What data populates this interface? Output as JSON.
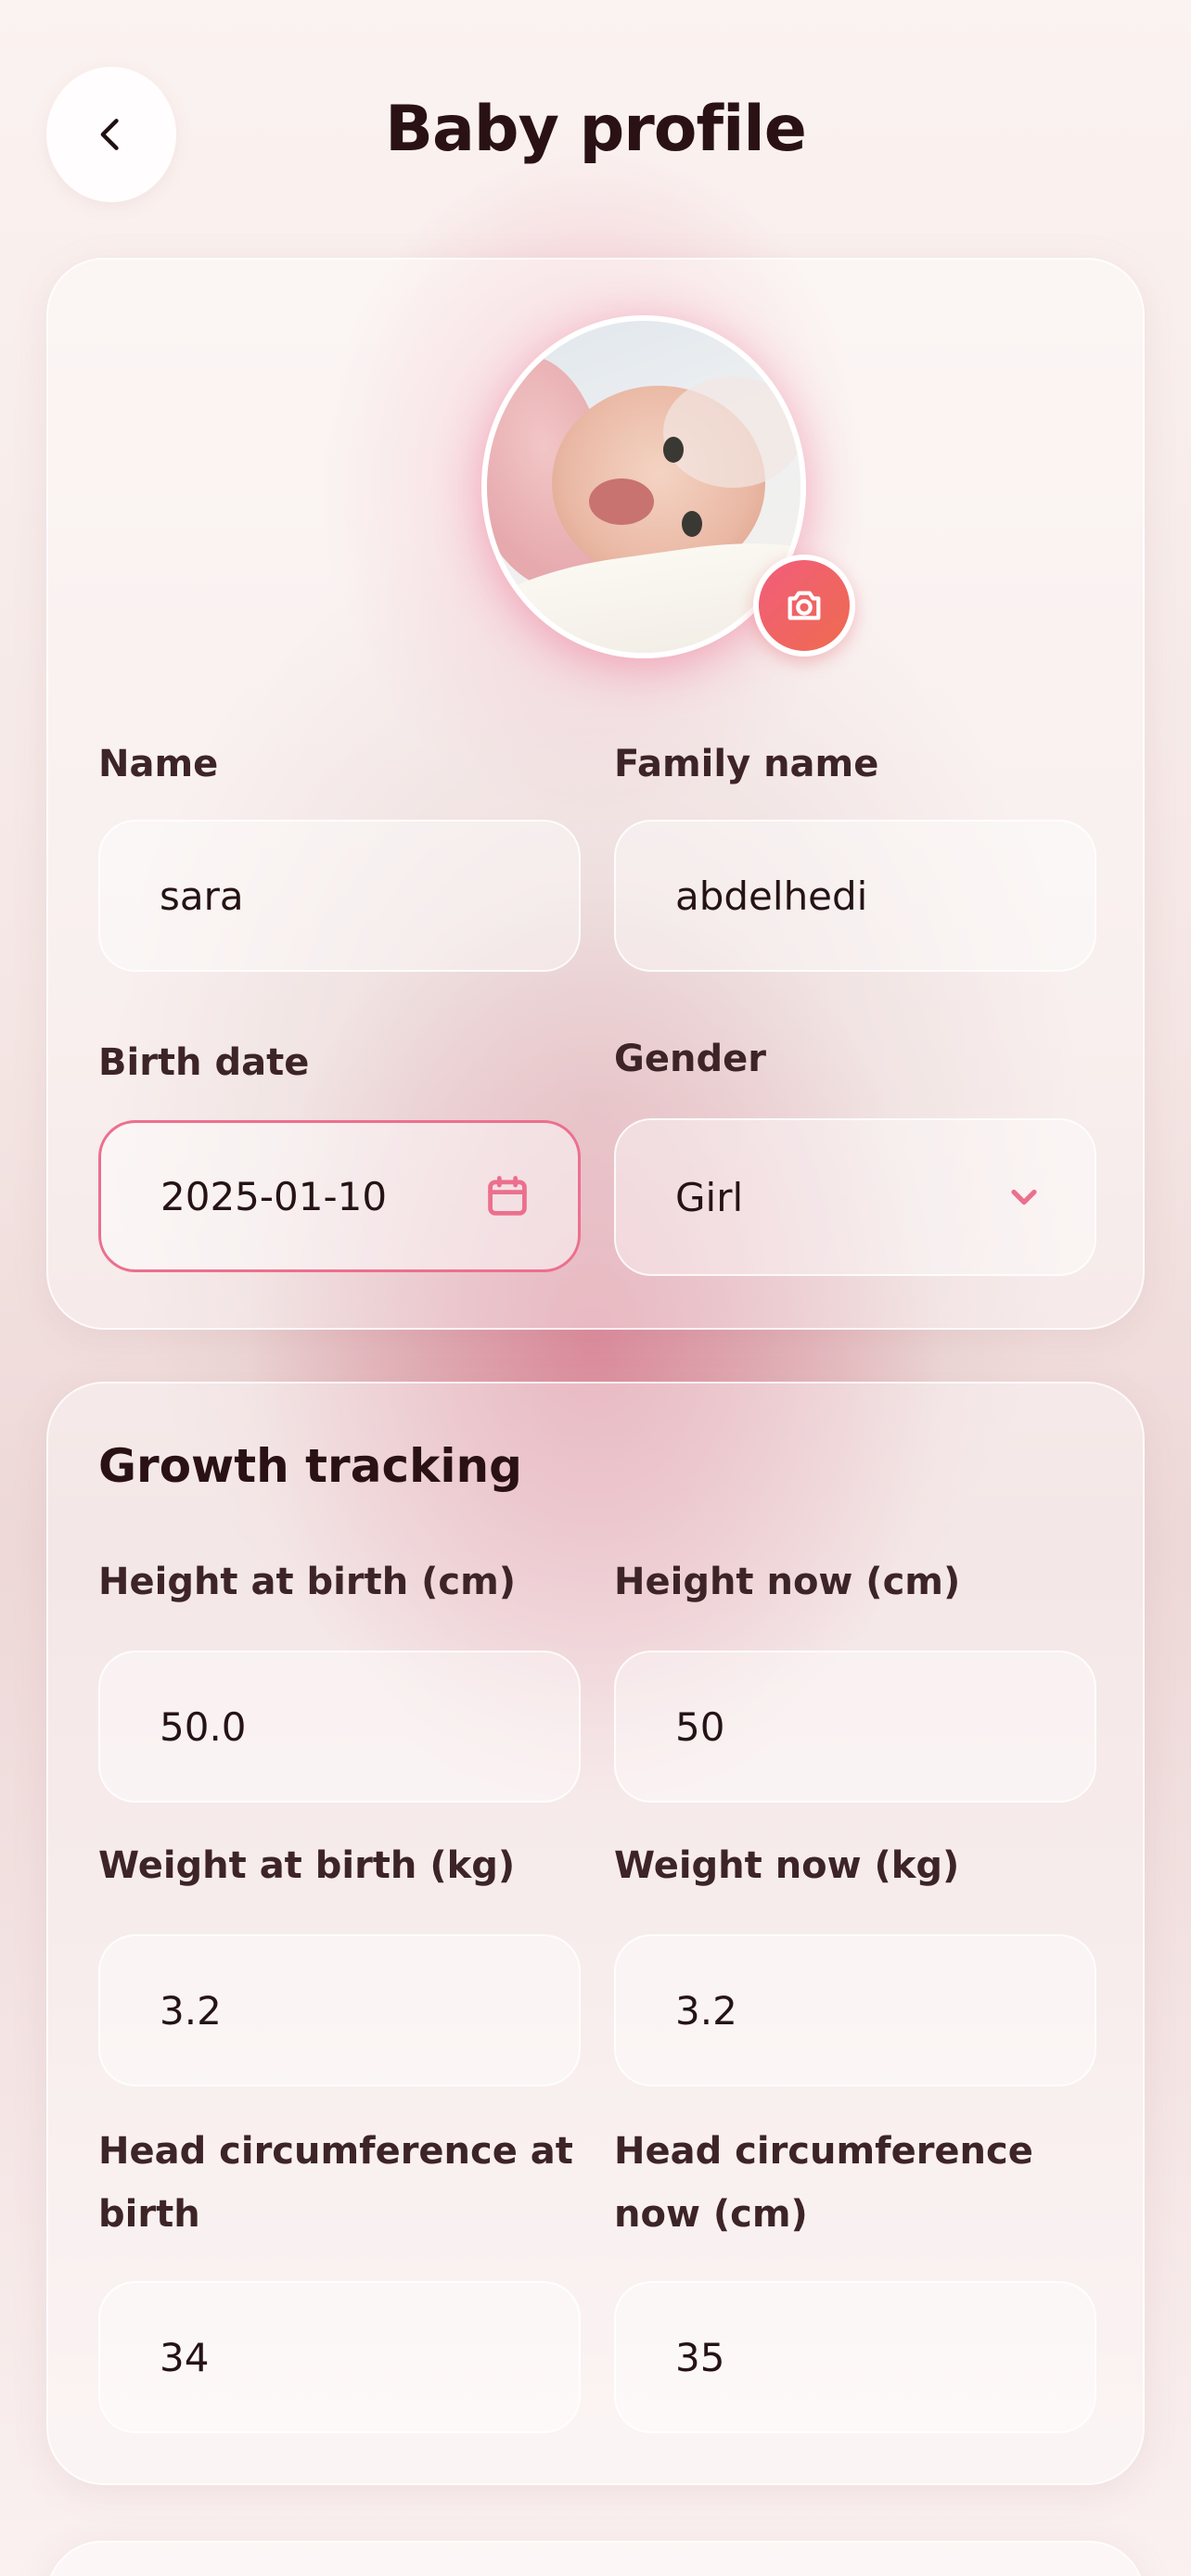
{
  "header": {
    "title": "Baby profile"
  },
  "profile": {
    "name_label": "Name",
    "name_value": "sara",
    "family_label": "Family name",
    "family_value": "abdelhedi",
    "birth_label": "Birth date",
    "birth_value": "2025-01-10",
    "gender_label": "Gender",
    "gender_value": "Girl"
  },
  "growth": {
    "title": "Growth tracking",
    "height_birth_label": "Height at birth (cm)",
    "height_birth_value": "50.0",
    "height_now_label": "Height now (cm)",
    "height_now_value": "50",
    "weight_birth_label": "Weight at birth (kg)",
    "weight_birth_value": "3.2",
    "weight_now_label": "Weight now (kg)",
    "weight_now_value": "3.2",
    "head_birth_label_1": "Head circumference at",
    "head_birth_label_2": "birth",
    "head_birth_value": "34",
    "head_now_label_1": "Head circumference",
    "head_now_label_2": "now (cm)",
    "head_now_value": "35"
  },
  "colors": {
    "accent": "#ec6f8e",
    "camera": "#f25d7b",
    "text": "#2a1214"
  },
  "icons": {
    "back": "chevron-left-icon",
    "camera": "camera-icon",
    "calendar": "calendar-icon",
    "dropdown": "chevron-down-icon"
  }
}
